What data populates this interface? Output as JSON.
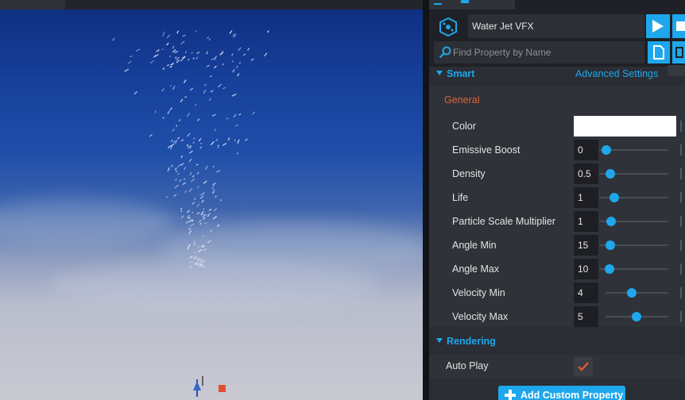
{
  "object": {
    "name": "Water Jet VFX"
  },
  "search": {
    "placeholder": "Find Property by Name"
  },
  "sections": {
    "smart": "Smart",
    "advanced_settings": "Advanced Settings",
    "general": "General",
    "rendering": "Rendering"
  },
  "properties": [
    {
      "label": "Color",
      "kind": "color",
      "value": "#ffffff"
    },
    {
      "label": "Emissive Boost",
      "kind": "slider",
      "value": "0",
      "slider_level": 0.1
    },
    {
      "label": "Density",
      "kind": "slider",
      "value": "0.5",
      "slider_level": 0.16
    },
    {
      "label": "Life",
      "kind": "slider",
      "value": "1",
      "slider_level": 0.22
    },
    {
      "label": "Particle Scale Multiplier",
      "kind": "slider",
      "value": "1",
      "slider_level": 0.17
    },
    {
      "label": "Angle Min",
      "kind": "slider",
      "value": "15",
      "slider_level": 0.16
    },
    {
      "label": "Angle Max",
      "kind": "slider",
      "value": "10",
      "slider_level": 0.15
    },
    {
      "label": "Velocity Min",
      "kind": "slider",
      "value": "4",
      "slider_level": 0.42
    },
    {
      "label": "Velocity Max",
      "kind": "slider",
      "value": "5",
      "slider_level": 0.5
    }
  ],
  "rendering": {
    "auto_play_label": "Auto Play",
    "auto_play_checked": true
  },
  "add_custom_property": "Add Custom Property",
  "colors": {
    "accent": "#1ea7ec",
    "general_header": "#d9653b",
    "checkmark": "#e05a34"
  }
}
